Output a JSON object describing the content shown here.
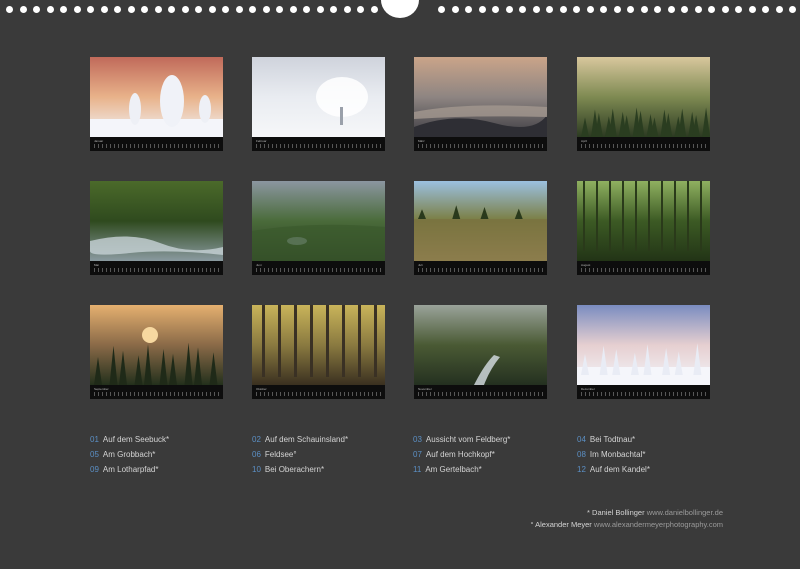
{
  "months": [
    {
      "label": "Januar",
      "colors": [
        "#c06a5a",
        "#e8b28a",
        "#f2f3f7"
      ],
      "scene": "snow-trees"
    },
    {
      "label": "Februar",
      "colors": [
        "#cfd3dc",
        "#e9ecf1",
        "#f6f7f9"
      ],
      "scene": "lone-tree"
    },
    {
      "label": "März",
      "colors": [
        "#caa489",
        "#8e8582",
        "#3c3c42"
      ],
      "scene": "fog-hills"
    },
    {
      "label": "April",
      "colors": [
        "#d8c79d",
        "#7e8a52",
        "#2c3a22"
      ],
      "scene": "misty-forest"
    },
    {
      "label": "Mai",
      "colors": [
        "#4b6a2a",
        "#2f4a1e",
        "#8a9aa0"
      ],
      "scene": "stream"
    },
    {
      "label": "Juni",
      "colors": [
        "#8b96a0",
        "#4a6b3a",
        "#2a3c22"
      ],
      "scene": "lake-valley"
    },
    {
      "label": "Juli",
      "colors": [
        "#9bc0e0",
        "#7a7d40",
        "#b59a6a"
      ],
      "scene": "meadow"
    },
    {
      "label": "August",
      "colors": [
        "#8fb060",
        "#3c5a24",
        "#223416"
      ],
      "scene": "green-forest"
    },
    {
      "label": "September",
      "colors": [
        "#e5b070",
        "#8a6a48",
        "#23301c"
      ],
      "scene": "sunset-firs"
    },
    {
      "label": "Oktober",
      "colors": [
        "#c9b45a",
        "#8a7a40",
        "#3a3020"
      ],
      "scene": "autumn-forest"
    },
    {
      "label": "November",
      "colors": [
        "#9aa39a",
        "#4a5a34",
        "#243020"
      ],
      "scene": "mossy-stream"
    },
    {
      "label": "Dezember",
      "colors": [
        "#7a8cc0",
        "#e6cfd0",
        "#f3f5fa"
      ],
      "scene": "snow-firs"
    }
  ],
  "legend": [
    {
      "num": "01",
      "name": "Auf dem Seebuck*"
    },
    {
      "num": "02",
      "name": "Auf dem Schauinsland*"
    },
    {
      "num": "03",
      "name": "Aussicht vom Feldberg*"
    },
    {
      "num": "04",
      "name": "Bei Todtnau*"
    },
    {
      "num": "05",
      "name": "Am Grobbach*"
    },
    {
      "num": "06",
      "name": "Feldsee°"
    },
    {
      "num": "07",
      "name": "Auf dem Hochkopf*"
    },
    {
      "num": "08",
      "name": "Im Monbachtal*"
    },
    {
      "num": "09",
      "name": "Am Lotharpfad*"
    },
    {
      "num": "10",
      "name": "Bei Oberachern*"
    },
    {
      "num": "11",
      "name": "Am Gertelbach*"
    },
    {
      "num": "12",
      "name": "Auf dem Kandel*"
    }
  ],
  "credits": [
    {
      "name": "* Daniel Bollinger",
      "url": "www.danielbollinger.de"
    },
    {
      "name": "° Alexander Meyer",
      "url": "www.alexandermeyerphotography.com"
    }
  ]
}
